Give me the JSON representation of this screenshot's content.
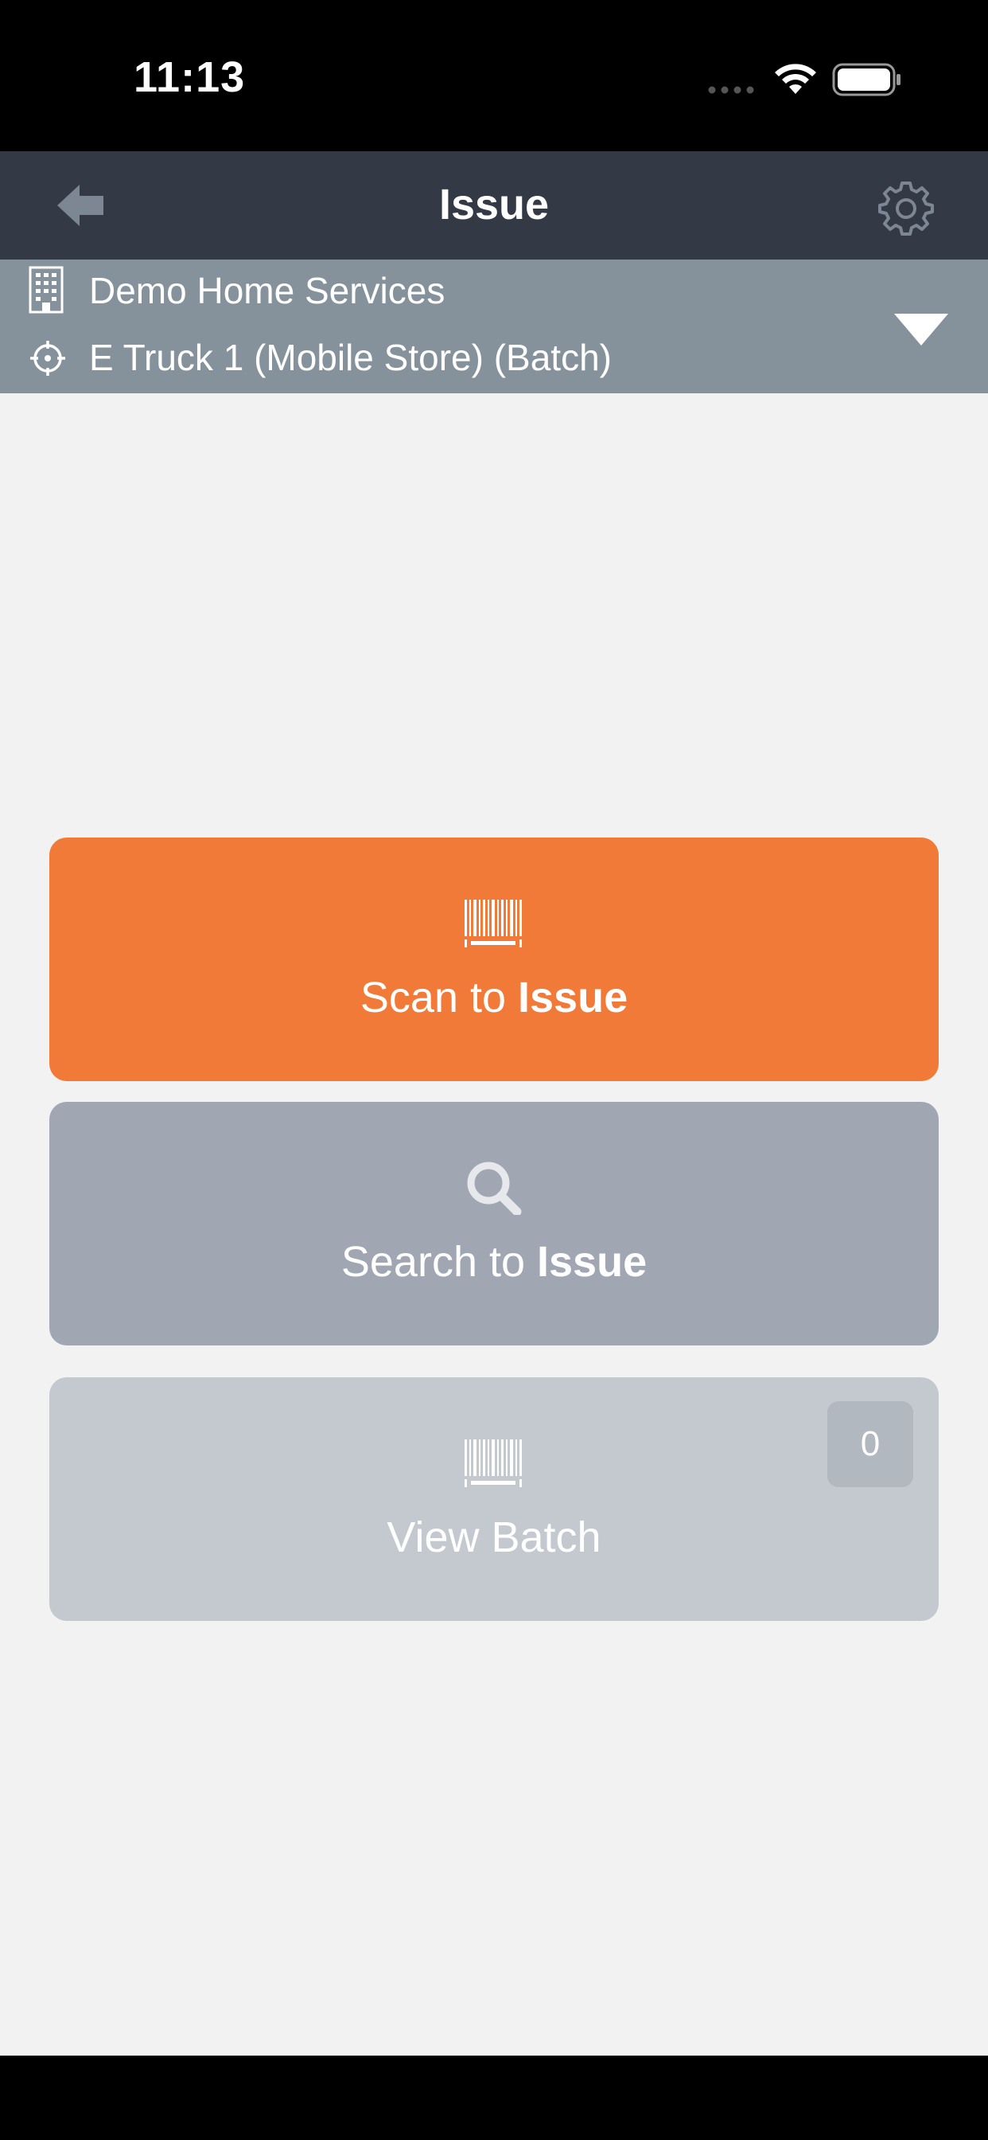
{
  "status_bar": {
    "time": "11:13"
  },
  "nav": {
    "title": "Issue",
    "back_icon": "back-arrow-icon",
    "settings_icon": "gear-icon"
  },
  "context": {
    "company": "Demo Home Services",
    "location": "E Truck 1 (Mobile Store) (Batch)",
    "company_icon": "building-icon",
    "location_icon": "crosshair-icon",
    "dropdown_icon": "caret-down-icon"
  },
  "actions": {
    "scan": {
      "prefix": "Scan to ",
      "bold": "Issue",
      "icon": "barcode-icon",
      "color": "#f27a38"
    },
    "search": {
      "prefix": "Search to ",
      "bold": "Issue",
      "icon": "search-icon",
      "color": "#a0a7b3"
    },
    "batch": {
      "label": "View Batch",
      "count": "0",
      "icon": "barcode-icon",
      "color": "#c4c9cf"
    }
  },
  "colors": {
    "nav_bg": "#333a45",
    "context_bg": "#86929b",
    "page_bg": "#f2f2f2"
  }
}
